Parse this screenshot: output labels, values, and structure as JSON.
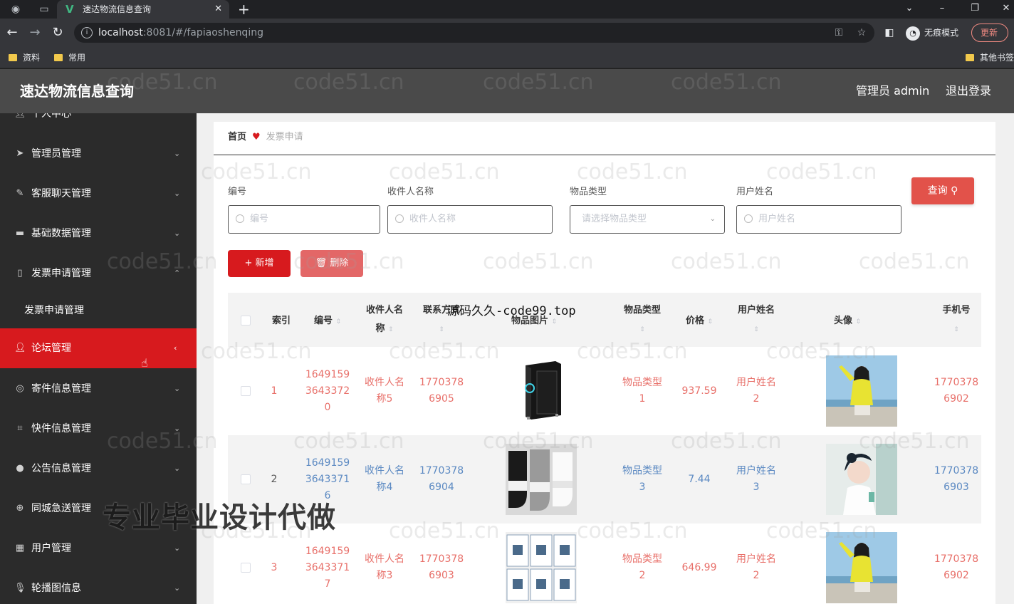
{
  "browser": {
    "tab_title": "速达物流信息查询",
    "url_host": "localhost",
    "url_rest": ":8081/#/fapiaoshenqing",
    "incognito_label": "无痕模式",
    "update_label": "更新",
    "bookmarks": [
      "资料",
      "常用"
    ],
    "other_bookmarks": "其他书签"
  },
  "header": {
    "title": "速达物流信息查询",
    "user": "管理员 admin",
    "logout": "退出登录"
  },
  "sidebar": {
    "items": [
      {
        "label": "个人中心",
        "icon": "user-icon"
      },
      {
        "label": "管理员管理",
        "icon": "send-icon"
      },
      {
        "label": "客服聊天管理",
        "icon": "edit-off-icon"
      },
      {
        "label": "基础数据管理",
        "icon": "database-icon"
      },
      {
        "label": "发票申请管理",
        "icon": "phone-icon"
      },
      {
        "label": "发票申请管理",
        "icon": ""
      },
      {
        "label": "论坛管理",
        "icon": "user-icon"
      },
      {
        "label": "寄件信息管理",
        "icon": "target-icon"
      },
      {
        "label": "快件信息管理",
        "icon": "crop-icon"
      },
      {
        "label": "公告信息管理",
        "icon": "bulb-icon"
      },
      {
        "label": "同城急送管理",
        "icon": "globe-icon"
      },
      {
        "label": "用户管理",
        "icon": "grid-icon"
      },
      {
        "label": "轮播图信息",
        "icon": "mic-icon"
      }
    ]
  },
  "breadcrumb": {
    "home": "首页",
    "current": "发票申请"
  },
  "filters": {
    "labels": [
      "编号",
      "收件人名称",
      "物品类型",
      "用户姓名"
    ],
    "placeholders": [
      "编号",
      "收件人名称",
      "请选择物品类型",
      "用户姓名"
    ],
    "search_label": "查询"
  },
  "actions": {
    "add": "+ 新增",
    "delete": "删除"
  },
  "table": {
    "headers": {
      "index": "索引",
      "code_no": "编号",
      "receiver_1": "收件人名",
      "receiver_2": "称",
      "phone": "联系方式",
      "image": "物品图片",
      "type": "物品类型",
      "price": "价格",
      "username": "用户姓名",
      "avatar": "头像",
      "mobile": "手机号"
    },
    "rows": [
      {
        "index": "1",
        "code": [
          "1649159",
          "3643372",
          "0"
        ],
        "receiver": [
          "收件人名",
          "称5"
        ],
        "phone": [
          "1770378",
          "6905"
        ],
        "type": [
          "物品类型",
          "1"
        ],
        "price": "937.59",
        "username": [
          "用户姓名",
          "2"
        ],
        "mobile": [
          "1770378",
          "6902"
        ]
      },
      {
        "index": "2",
        "code": [
          "1649159",
          "3643371",
          "6"
        ],
        "receiver": [
          "收件人名",
          "称4"
        ],
        "phone": [
          "1770378",
          "6904"
        ],
        "type": [
          "物品类型",
          "3"
        ],
        "price": "7.44",
        "username": [
          "用户姓名",
          "3"
        ],
        "mobile": [
          "1770378",
          "6903"
        ]
      },
      {
        "index": "3",
        "code": [
          "1649159",
          "3643371",
          "7"
        ],
        "receiver": [
          "收件人名",
          "称3"
        ],
        "phone": [
          "1770378",
          "6903"
        ],
        "type": [
          "物品类型",
          "2"
        ],
        "price": "646.99",
        "username": [
          "用户姓名",
          "2"
        ],
        "mobile": [
          "1770378",
          "6902"
        ]
      }
    ]
  },
  "watermark": "code51.cn",
  "overlay_caption": "源码久久-code99.top",
  "overlay_banner": "专业毕业设计代做",
  "colors": {
    "accent": "#d71a1e",
    "link_red": "#e8706a",
    "link_blue": "#5b89c2",
    "header_bg": "#4a4a4a",
    "sidebar_bg": "#2b2b2b"
  }
}
